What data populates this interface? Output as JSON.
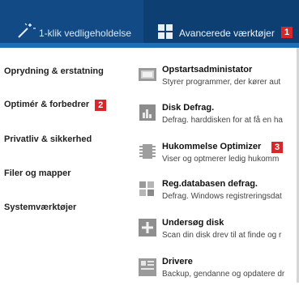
{
  "topbar": {
    "tab_maintenance": "1-klik vedligeholdelse",
    "tab_advanced": "Avancerede værktøjer",
    "tab_advanced_badge": "1"
  },
  "sidebar": {
    "items": [
      {
        "label": "Oprydning & erstatning"
      },
      {
        "label": "Optimér & forbedrer",
        "badge": "2"
      },
      {
        "label": "Privatliv & sikkerhed"
      },
      {
        "label": "Filer og mapper"
      },
      {
        "label": "Systemværktøjer"
      }
    ]
  },
  "tools": [
    {
      "title": "Opstartsadministator",
      "desc": "Styrer programmer, der kører aut",
      "icon": "startup-manager-icon"
    },
    {
      "title": "Disk Defrag.",
      "desc": "Defrag. harddisken for at få en ha",
      "icon": "disk-defrag-icon"
    },
    {
      "title": "Hukommelse Optimizer",
      "desc": "Viser og optmerer ledig hukomm",
      "icon": "memory-chip-icon",
      "badge": "3"
    },
    {
      "title": "Reg.databasen defrag.",
      "desc": "Defrag. Windows registreringsdat",
      "icon": "registry-defrag-icon"
    },
    {
      "title": "Undersøg disk",
      "desc": "Scan din disk drev til at finde og r",
      "icon": "check-disk-icon"
    },
    {
      "title": "Drivere",
      "desc": "Backup, gendanne og opdatere dr",
      "icon": "drivers-icon"
    }
  ],
  "colors": {
    "topbar": "#0e3f73",
    "accent": "#1b6fb8",
    "badge": "#d9262b"
  }
}
